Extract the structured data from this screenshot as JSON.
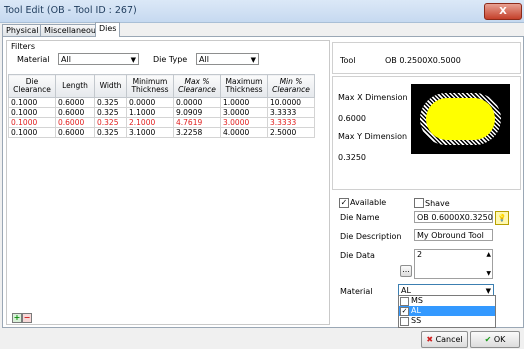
{
  "window": {
    "title": "Tool Edit (OB - Tool ID : 267)",
    "close_glyph": "X"
  },
  "tabs": [
    {
      "label": "Physical"
    },
    {
      "label": "Miscellaneous"
    },
    {
      "label": "Dies"
    }
  ],
  "filters": {
    "group_label": "Filters",
    "material_label": "Material",
    "material_value": "All",
    "die_type_label": "Die Type",
    "die_type_value": "All"
  },
  "grid": {
    "columns": [
      "Die Clearance",
      "Length",
      "Width",
      "Minimum Thickness",
      "Max % Clearance",
      "Maximum Thickness",
      "Min % Clearance"
    ],
    "rows": [
      [
        "0.1000",
        "0.6000",
        "0.325",
        "0.0000",
        "0.0000",
        "1.0000",
        "10.0000"
      ],
      [
        "0.1000",
        "0.6000",
        "0.325",
        "1.1000",
        "9.0909",
        "3.0000",
        "3.3333"
      ],
      [
        "0.1000",
        "0.6000",
        "0.325",
        "2.1000",
        "4.7619",
        "3.0000",
        "3.3333"
      ],
      [
        "0.1000",
        "0.6000",
        "0.325",
        "3.1000",
        "3.2258",
        "4.0000",
        "2.5000"
      ]
    ],
    "add_glyph": "+",
    "remove_glyph": "−"
  },
  "tool": {
    "label": "Tool",
    "value": "OB 0.2500X0.5000"
  },
  "dimensions": {
    "max_x_label": "Max X Dimension",
    "max_x_value": "0.6000",
    "max_y_label": "Max Y Dimension",
    "max_y_value": "0.3250"
  },
  "form": {
    "available_label": "Available",
    "available_checked": "✓",
    "shave_label": "Shave",
    "die_name_label": "Die Name",
    "die_name_value": "OB 0.6000X0.3250",
    "die_description_label": "Die Description",
    "die_description_value": "My Obround Tool",
    "die_data_label": "Die Data",
    "die_data_value": "2",
    "die_data_button": "...",
    "material_label": "Material",
    "material_value": "AL"
  },
  "material_options": [
    {
      "label": "MS",
      "checked": ""
    },
    {
      "label": "AL",
      "checked": "✓"
    },
    {
      "label": "SS",
      "checked": ""
    }
  ],
  "buttons": {
    "cancel": "Cancel",
    "ok": "OK"
  },
  "colors": {
    "highlight_row": "#e02020",
    "selection": "#3399ff",
    "preview_fill": "#ffff00"
  }
}
